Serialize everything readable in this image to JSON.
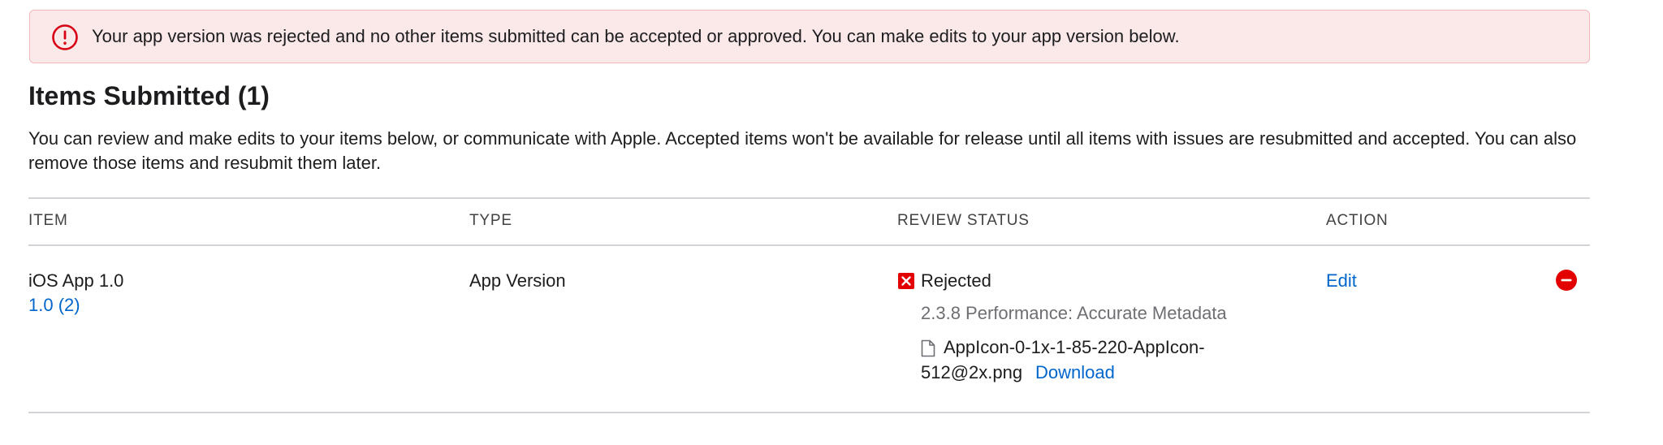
{
  "alert": {
    "icon": "exclamation-circle-icon",
    "message": "Your app version was rejected and no other items submitted can be accepted or approved. You can make edits to your app version below.",
    "color": "#d70015"
  },
  "section": {
    "title": "Items Submitted (1)",
    "description": "You can review and make edits to your items below, or communicate with Apple. Accepted items won't be available for release until all items with issues are resubmitted and accepted. You can also remove those items and resubmit them later."
  },
  "table": {
    "headers": {
      "item": "ITEM",
      "type": "TYPE",
      "status": "REVIEW STATUS",
      "action": "ACTION"
    },
    "rows": [
      {
        "item_name": "iOS App 1.0",
        "item_build": "1.0 (2)",
        "type": "App Version",
        "status_icon": "rejected-x-icon",
        "status": "Rejected",
        "guideline": "2.3.8 Performance: Accurate Metadata",
        "attachment_icon": "document-icon",
        "attachment_line1": "AppIcon-0-1x-1-85-220-AppIcon-",
        "attachment_line2": "512@2x.png",
        "download_label": "Download",
        "action_label": "Edit",
        "remove_icon": "remove-circle-icon"
      }
    ]
  },
  "colors": {
    "link": "#0066cc",
    "danger": "#e30000",
    "alert_background": "#fbe9ea"
  }
}
